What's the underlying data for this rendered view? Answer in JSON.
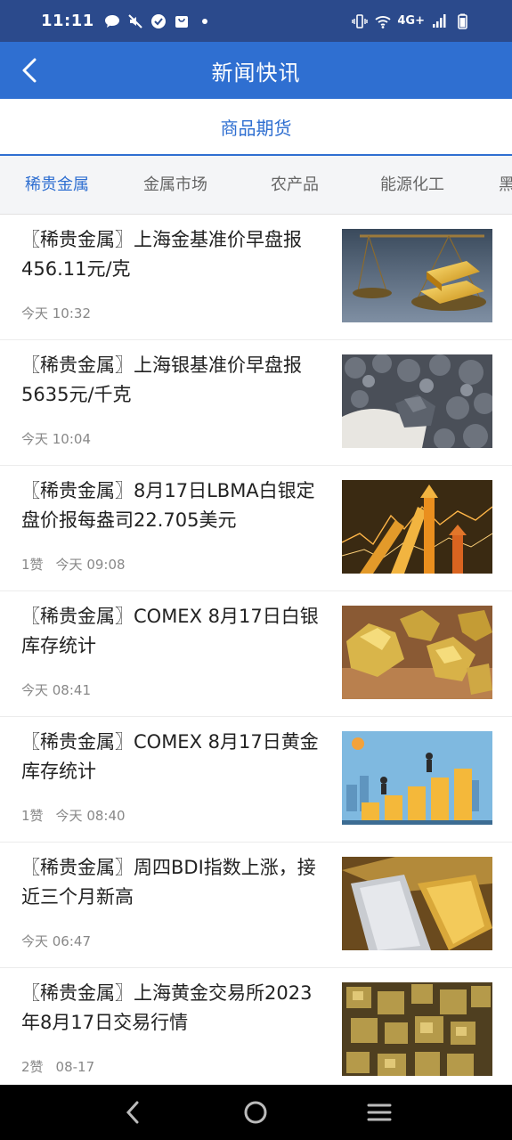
{
  "status": {
    "time": "11:11",
    "network": "4G+"
  },
  "header": {
    "title": "新闻快讯"
  },
  "subheader": {
    "label": "商品期货"
  },
  "tabs": [
    {
      "label": "稀贵金属",
      "active": true
    },
    {
      "label": "金属市场",
      "active": false
    },
    {
      "label": "农产品",
      "active": false
    },
    {
      "label": "能源化工",
      "active": false
    },
    {
      "label": "黑",
      "active": false
    }
  ],
  "colors": {
    "statusbar": "#2b4a8c",
    "header": "#2f6fd1",
    "accent": "#2f6fd1"
  },
  "news": [
    {
      "title": "〖稀贵金属〗上海金基准价早盘报456.11元/克",
      "likes": "",
      "time": "今天 10:32",
      "image": "gold-bars-on-scale"
    },
    {
      "title": "〖稀贵金属〗上海银基准价早盘报5635元/千克",
      "likes": "",
      "time": "今天 10:04",
      "image": "silver-ore-in-hand"
    },
    {
      "title": "〖稀贵金属〗8月17日LBMA白银定盘价报每盎司22.705美元",
      "likes": "1赞",
      "time": "今天 09:08",
      "image": "rising-arrows-chart"
    },
    {
      "title": "〖稀贵金属〗COMEX 8月17日白银库存统计",
      "likes": "",
      "time": "今天 08:41",
      "image": "gold-nuggets"
    },
    {
      "title": "〖稀贵金属〗COMEX 8月17日黄金库存统计",
      "likes": "1赞",
      "time": "今天 08:40",
      "image": "businessmen-climbing-coins"
    },
    {
      "title": "〖稀贵金属〗周四BDI指数上涨，接近三个月新高",
      "likes": "",
      "time": "今天 06:47",
      "image": "silver-and-gold-bars"
    },
    {
      "title": "〖稀贵金属〗上海黄金交易所2023年8月17日交易行情",
      "likes": "2赞",
      "time": "08-17",
      "image": "pyrite-crystals"
    }
  ]
}
